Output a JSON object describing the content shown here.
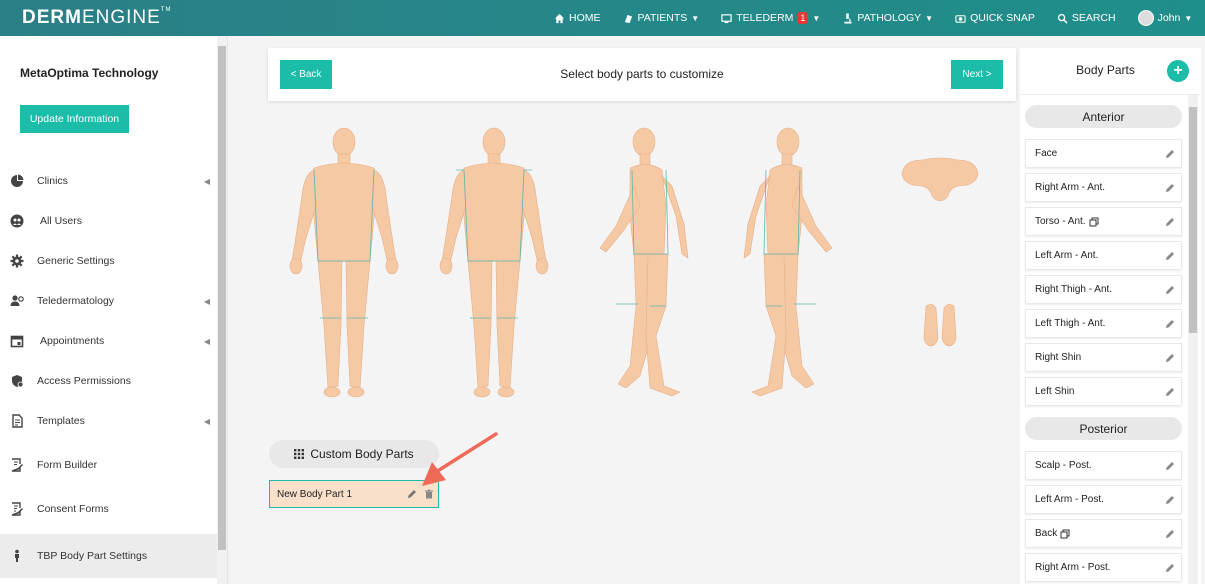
{
  "brand": {
    "bold": "DERM",
    "light": "ENGINE",
    "tm": "TM"
  },
  "nav": {
    "home": "HOME",
    "patients": "PATIENTS",
    "telederm": "TELEDERM",
    "telederm_badge": "1",
    "pathology": "PATHOLOGY",
    "quick_snap": "QUICK SNAP",
    "search": "SEARCH",
    "user": "John"
  },
  "sidebar": {
    "org_name": "MetaOptima Technology",
    "update_button": "Update Information",
    "items": [
      {
        "label": "Clinics",
        "icon": "pie-chart-icon",
        "caret": true
      },
      {
        "label": "All Users",
        "icon": "users-icon",
        "caret": false
      },
      {
        "label": "Generic Settings",
        "icon": "gear-icon",
        "caret": false
      },
      {
        "label": "Teledermatology",
        "icon": "user-gear-icon",
        "caret": true
      },
      {
        "label": "Appointments",
        "icon": "calendar-icon",
        "caret": true
      },
      {
        "label": "Access Permissions",
        "icon": "shield-icon",
        "caret": false
      },
      {
        "label": "Templates",
        "icon": "document-icon",
        "caret": true
      },
      {
        "label": "Form Builder",
        "icon": "form-edit-icon",
        "caret": false
      },
      {
        "label": "Consent Forms",
        "icon": "form-sign-icon",
        "caret": false
      },
      {
        "label": "TBP Body Part Settings",
        "icon": "person-icon",
        "caret": false
      }
    ]
  },
  "main": {
    "back_button": "< Back",
    "next_button": "Next >",
    "title": "Select body parts to customize",
    "custom_header": "Custom Body Parts",
    "custom_items": [
      {
        "label": "New Body Part 1"
      }
    ]
  },
  "right_panel": {
    "title": "Body Parts",
    "anterior_header": "Anterior",
    "anterior": [
      {
        "label": "Face",
        "copy": false
      },
      {
        "label": "Right Arm - Ant.",
        "copy": false
      },
      {
        "label": "Torso - Ant.",
        "copy": true
      },
      {
        "label": "Left Arm - Ant.",
        "copy": false
      },
      {
        "label": "Right Thigh - Ant.",
        "copy": false
      },
      {
        "label": "Left Thigh - Ant.",
        "copy": false
      },
      {
        "label": "Right Shin",
        "copy": false
      },
      {
        "label": "Left Shin",
        "copy": false
      }
    ],
    "posterior_header": "Posterior",
    "posterior": [
      {
        "label": "Scalp - Post.",
        "copy": false
      },
      {
        "label": "Left Arm - Post.",
        "copy": false
      },
      {
        "label": "Back",
        "copy": true
      },
      {
        "label": "Right Arm - Post.",
        "copy": false
      }
    ]
  },
  "colors": {
    "accent": "#1bbca8",
    "nav_bg": "#2b7f86",
    "skin": "#f5c9a3",
    "custom_item_bg": "#f9e0cb",
    "arrow": "#f06a5a"
  }
}
